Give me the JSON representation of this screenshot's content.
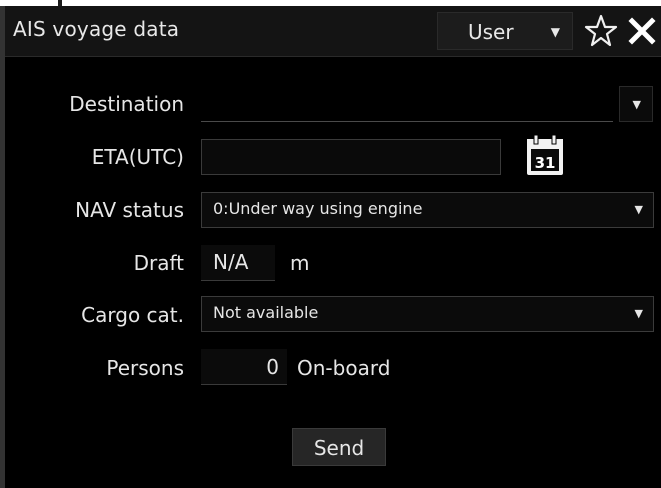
{
  "window": {
    "title": "AIS voyage data",
    "user_dropdown": {
      "label": "User",
      "icon": "chevron-down-icon"
    },
    "star_icon": "star-outline-icon",
    "close_icon": "close-icon"
  },
  "form": {
    "destination": {
      "label": "Destination",
      "value": ""
    },
    "eta": {
      "label": "ETA(UTC)",
      "value": "",
      "calendar_day": "31"
    },
    "nav_status": {
      "label": "NAV status",
      "selected": "0:Under way using engine"
    },
    "draft": {
      "label": "Draft",
      "value": "N/A",
      "unit": "m"
    },
    "cargo_cat": {
      "label": "Cargo cat.",
      "selected": "Not available"
    },
    "persons": {
      "label": "Persons",
      "value": "0",
      "unit": "On-board"
    }
  },
  "actions": {
    "send_label": "Send"
  },
  "colors": {
    "background": "#000000",
    "text": "#e6e6e6",
    "field_border": "#3a3a3a"
  }
}
